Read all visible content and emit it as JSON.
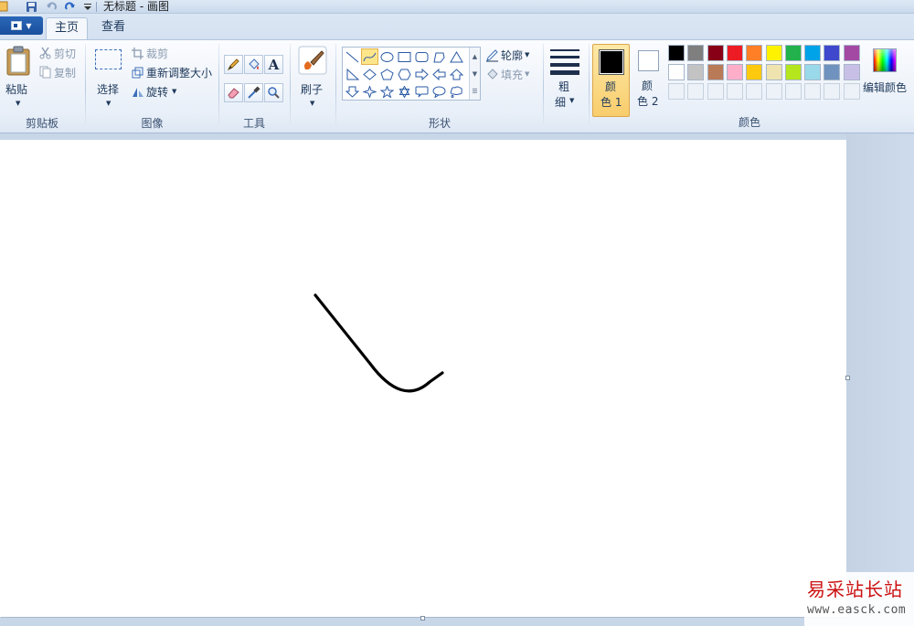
{
  "window": {
    "title": "无标题 - 画图"
  },
  "tabs": [
    {
      "label": "主页",
      "active": true
    },
    {
      "label": "查看",
      "active": false
    }
  ],
  "groups": {
    "clipboard": {
      "label": "剪贴板",
      "paste": "粘贴",
      "cut": "剪切",
      "copy": "复制"
    },
    "image": {
      "label": "图像",
      "select": "选择",
      "crop": "裁剪",
      "resize": "重新调整大小",
      "rotate": "旋转"
    },
    "tools": {
      "label": "工具"
    },
    "brushes": {
      "label": "刷子"
    },
    "shapes": {
      "label": "形状",
      "outline": "轮廓",
      "fill": "填充"
    },
    "size": {
      "label_line1": "粗",
      "label_line2": "细"
    },
    "colors": {
      "label": "颜色",
      "color1_line1": "颜",
      "color1_line2": "色 1",
      "color2_line1": "颜",
      "color2_line2": "色 2",
      "color1_value": "#000000",
      "color2_value": "#ffffff",
      "edit_colors": "编辑颜色",
      "palette_row1": [
        "#000000",
        "#7f7f7f",
        "#880015",
        "#ed1c24",
        "#ff7f27",
        "#fff200",
        "#22b14c",
        "#00a2e8",
        "#3f48cc",
        "#a349a4"
      ],
      "palette_row2": [
        "#ffffff",
        "#c3c3c3",
        "#b97a57",
        "#ffaec9",
        "#ffc90e",
        "#efe4b0",
        "#b5e61d",
        "#99d9ea",
        "#7092be",
        "#c8bfe7"
      ]
    }
  },
  "icons": {
    "save": "save-icon",
    "undo": "undo-icon",
    "redo": "redo-icon",
    "paste": "clipboard-icon",
    "brush": "brush-icon"
  },
  "watermark": {
    "title": "易采站长站",
    "url": "www.easck.com"
  }
}
